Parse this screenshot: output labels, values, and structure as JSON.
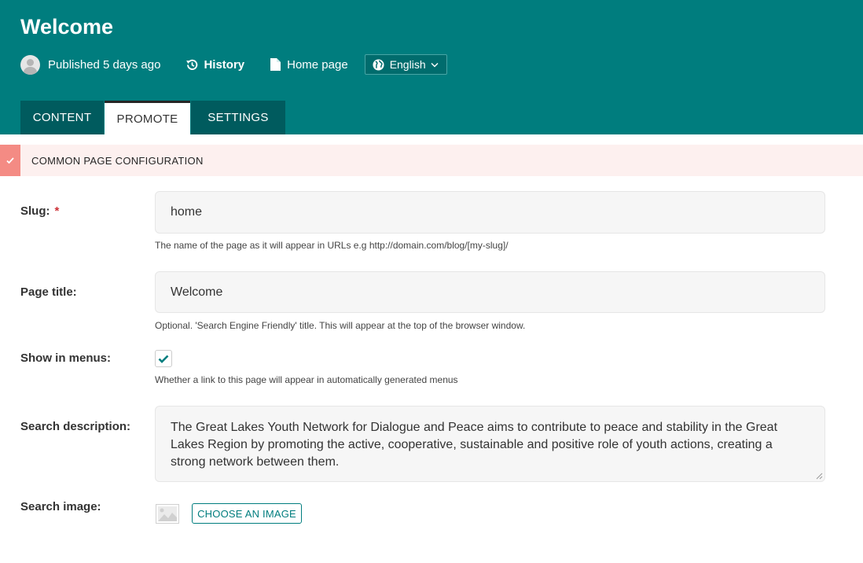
{
  "header": {
    "title": "Welcome",
    "status": "Published 5 days ago",
    "history_label": "History",
    "page_type_label": "Home page",
    "language": "English",
    "background_color": "#007d7e"
  },
  "tabs": [
    {
      "label": "CONTENT",
      "active": false
    },
    {
      "label": "PROMOTE",
      "active": true
    },
    {
      "label": "SETTINGS",
      "active": false
    }
  ],
  "section": {
    "title": "COMMON PAGE CONFIGURATION",
    "accent_color": "#f48b84"
  },
  "fields": {
    "slug": {
      "label": "Slug:",
      "required_marker": "*",
      "value": "home",
      "help": "The name of the page as it will appear in URLs e.g http://domain.com/blog/[my-slug]/"
    },
    "page_title": {
      "label": "Page title:",
      "value": "Welcome",
      "help": "Optional. 'Search Engine Friendly' title. This will appear at the top of the browser window."
    },
    "show_in_menus": {
      "label": "Show in menus:",
      "checked": true,
      "help": "Whether a link to this page will appear in automatically generated menus"
    },
    "search_description": {
      "label": "Search description:",
      "value": "The Great Lakes Youth Network for Dialogue and Peace aims to contribute to peace and stability in the Great Lakes Region by promoting the active, cooperative, sustainable and positive role of youth actions, creating a strong network between them."
    },
    "search_image": {
      "label": "Search image:",
      "button_label": "CHOOSE AN IMAGE"
    }
  },
  "icons": {
    "avatar": "avatar-icon",
    "history": "history-icon",
    "page": "document-icon",
    "language": "globe-icon",
    "dropdown": "chevron-down-icon",
    "collapse": "check-icon",
    "checkbox": "checkmark-icon",
    "image": "image-placeholder-icon"
  }
}
